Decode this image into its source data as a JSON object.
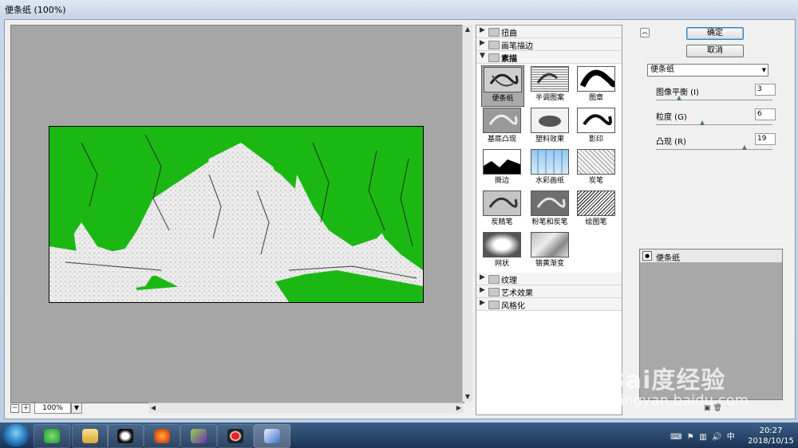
{
  "window": {
    "title": "便条纸 (100%)"
  },
  "preview": {
    "zoom": "100%",
    "zoom_out": "−",
    "zoom_in": "+"
  },
  "gallery": {
    "categories_top": [
      {
        "label": "扭曲",
        "expanded": false
      },
      {
        "label": "画笔描边",
        "expanded": false
      },
      {
        "label": "素描",
        "expanded": true
      }
    ],
    "thumbnails": [
      "便条纸",
      "半调图案",
      "图章",
      "基底凸现",
      "塑料效果",
      "影印",
      "撕边",
      "水彩画纸",
      "炭笔",
      "炭精笔",
      "粉笔和炭笔",
      "绘图笔",
      "网状",
      "铬黄渐变"
    ],
    "selected": "便条纸",
    "categories_bottom": [
      {
        "label": "纹理"
      },
      {
        "label": "艺术效果"
      },
      {
        "label": "风格化"
      }
    ]
  },
  "buttons": {
    "ok": "确定",
    "cancel": "取消"
  },
  "filter_select": "便条纸",
  "params": [
    {
      "label": "图像平衡 (I)",
      "value": "3",
      "level": 0.2
    },
    {
      "label": "粒度 (G)",
      "value": "6",
      "level": 0.4
    },
    {
      "label": "凸现 (R)",
      "value": "19",
      "level": 0.76
    }
  ],
  "layers": {
    "item": "便条纸"
  },
  "watermark": {
    "logo": "Bai度经验",
    "url": "jingyan.baidu.com"
  },
  "clock": {
    "time": "20:27",
    "date": "2018/10/15"
  },
  "colors": {
    "accent_green": "#1bb814",
    "preview_bg": "#a6a6a6"
  }
}
